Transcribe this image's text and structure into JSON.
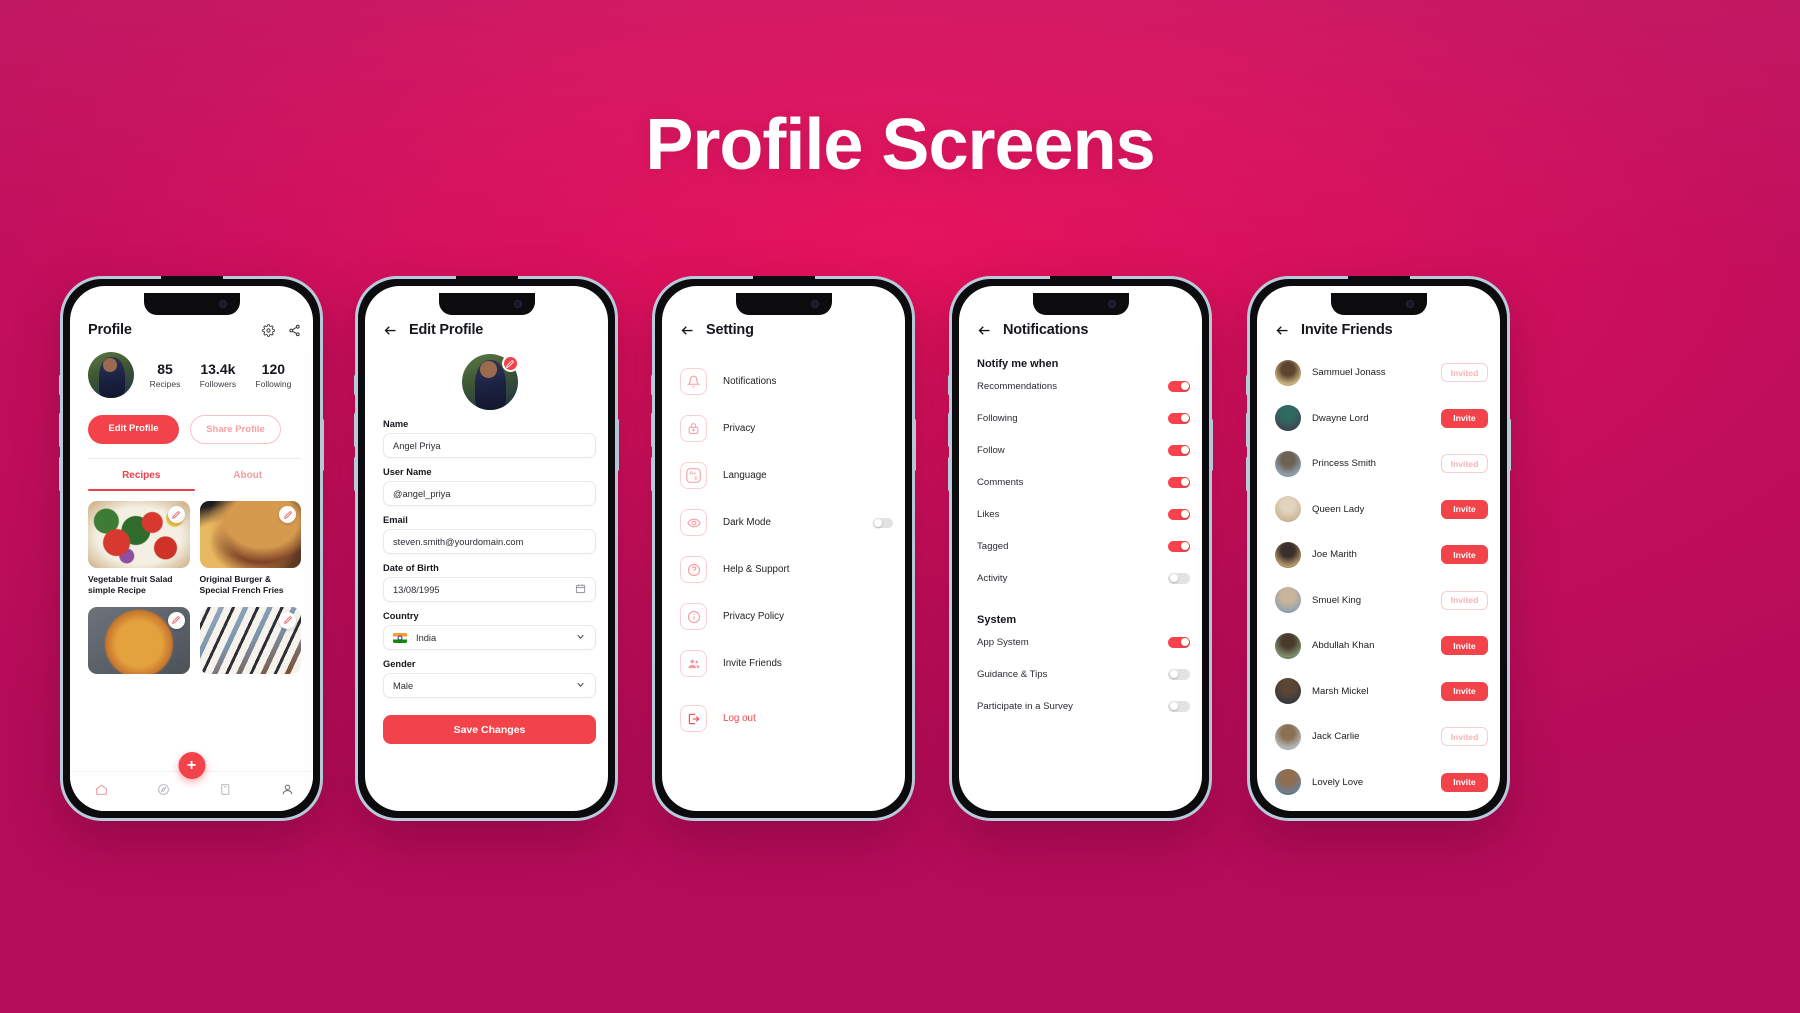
{
  "page": {
    "title": "Profile Screens",
    "accent": "#f2434b",
    "bg_from": "#e5125c",
    "bg_to": "#b40c59"
  },
  "phone1": {
    "title": "Profile",
    "icons": {
      "settings": "gear-icon",
      "share": "share-icon"
    },
    "stats": [
      {
        "num": "85",
        "label": "Recipes"
      },
      {
        "num": "13.4k",
        "label": "Followers"
      },
      {
        "num": "120",
        "label": "Following"
      }
    ],
    "buttons": {
      "edit": "Edit Profile",
      "share": "Share Profile"
    },
    "tabs": [
      {
        "label": "Recipes",
        "active": true
      },
      {
        "label": "About",
        "active": false
      }
    ],
    "recipes": [
      {
        "title": "Vegetable fruit Salad simple Recipe"
      },
      {
        "title": "Original Burger & Special French Fries"
      },
      {
        "title": ""
      },
      {
        "title": ""
      }
    ],
    "nav": [
      "home-icon",
      "compass-icon",
      "book-icon",
      "user-icon"
    ],
    "fab": "+"
  },
  "phone2": {
    "title": "Edit Profile",
    "fields": [
      {
        "label": "Name",
        "value": "Angel Priya"
      },
      {
        "label": "User Name",
        "value": "@angel_priya"
      },
      {
        "label": "Email",
        "value": "steven.smith@yourdomain.com"
      },
      {
        "label": "Date of Birth",
        "value": "13/08/1995"
      },
      {
        "label": "Country",
        "value": "India"
      },
      {
        "label": "Gender",
        "value": "Male"
      }
    ],
    "save_label": "Save Changes"
  },
  "phone3": {
    "title": "Setting",
    "items": [
      {
        "label": "Notifications",
        "icon": "bell-icon",
        "toggle": null
      },
      {
        "label": "Privacy",
        "icon": "lock-icon",
        "toggle": null
      },
      {
        "label": "Language",
        "icon": "language-icon",
        "toggle": null
      },
      {
        "label": "Dark Mode",
        "icon": "eye-icon",
        "toggle": false
      },
      {
        "label": "Help & Support",
        "icon": "question-icon",
        "toggle": null
      },
      {
        "label": "Privacy Policy",
        "icon": "info-icon",
        "toggle": null
      },
      {
        "label": "Invite Friends",
        "icon": "people-icon",
        "toggle": null
      },
      {
        "label": "Log out",
        "icon": "logout-icon",
        "toggle": null
      }
    ]
  },
  "phone4": {
    "title": "Notifications",
    "section1": {
      "heading": "Notify me when",
      "rows": [
        {
          "label": "Recommendations",
          "on": true
        },
        {
          "label": "Following",
          "on": true
        },
        {
          "label": "Follow",
          "on": true
        },
        {
          "label": "Comments",
          "on": true
        },
        {
          "label": "Likes",
          "on": true
        },
        {
          "label": "Tagged",
          "on": true
        },
        {
          "label": "Activity",
          "on": false
        }
      ]
    },
    "section2": {
      "heading": "System",
      "rows": [
        {
          "label": "App System",
          "on": true
        },
        {
          "label": "Guidance & Tips",
          "on": false
        },
        {
          "label": "Participate in a Survey",
          "on": false
        }
      ]
    }
  },
  "phone5": {
    "title": "Invite Friends",
    "friends": [
      {
        "name": "Sammuel Jonass",
        "action": "Invited",
        "invited": true
      },
      {
        "name": "Dwayne Lord",
        "action": "Invite",
        "invited": false
      },
      {
        "name": "Princess Smith",
        "action": "Invited",
        "invited": true
      },
      {
        "name": "Queen Lady",
        "action": "Invite",
        "invited": false
      },
      {
        "name": "Joe Marith",
        "action": "Invite",
        "invited": false
      },
      {
        "name": "Smuel King",
        "action": "Invited",
        "invited": true
      },
      {
        "name": "Abdullah Khan",
        "action": "Invite",
        "invited": false
      },
      {
        "name": "Marsh Mickel",
        "action": "Invite",
        "invited": false
      },
      {
        "name": "Jack Carlie",
        "action": "Invited",
        "invited": true
      },
      {
        "name": "Lovely Love",
        "action": "Invite",
        "invited": false
      }
    ]
  }
}
